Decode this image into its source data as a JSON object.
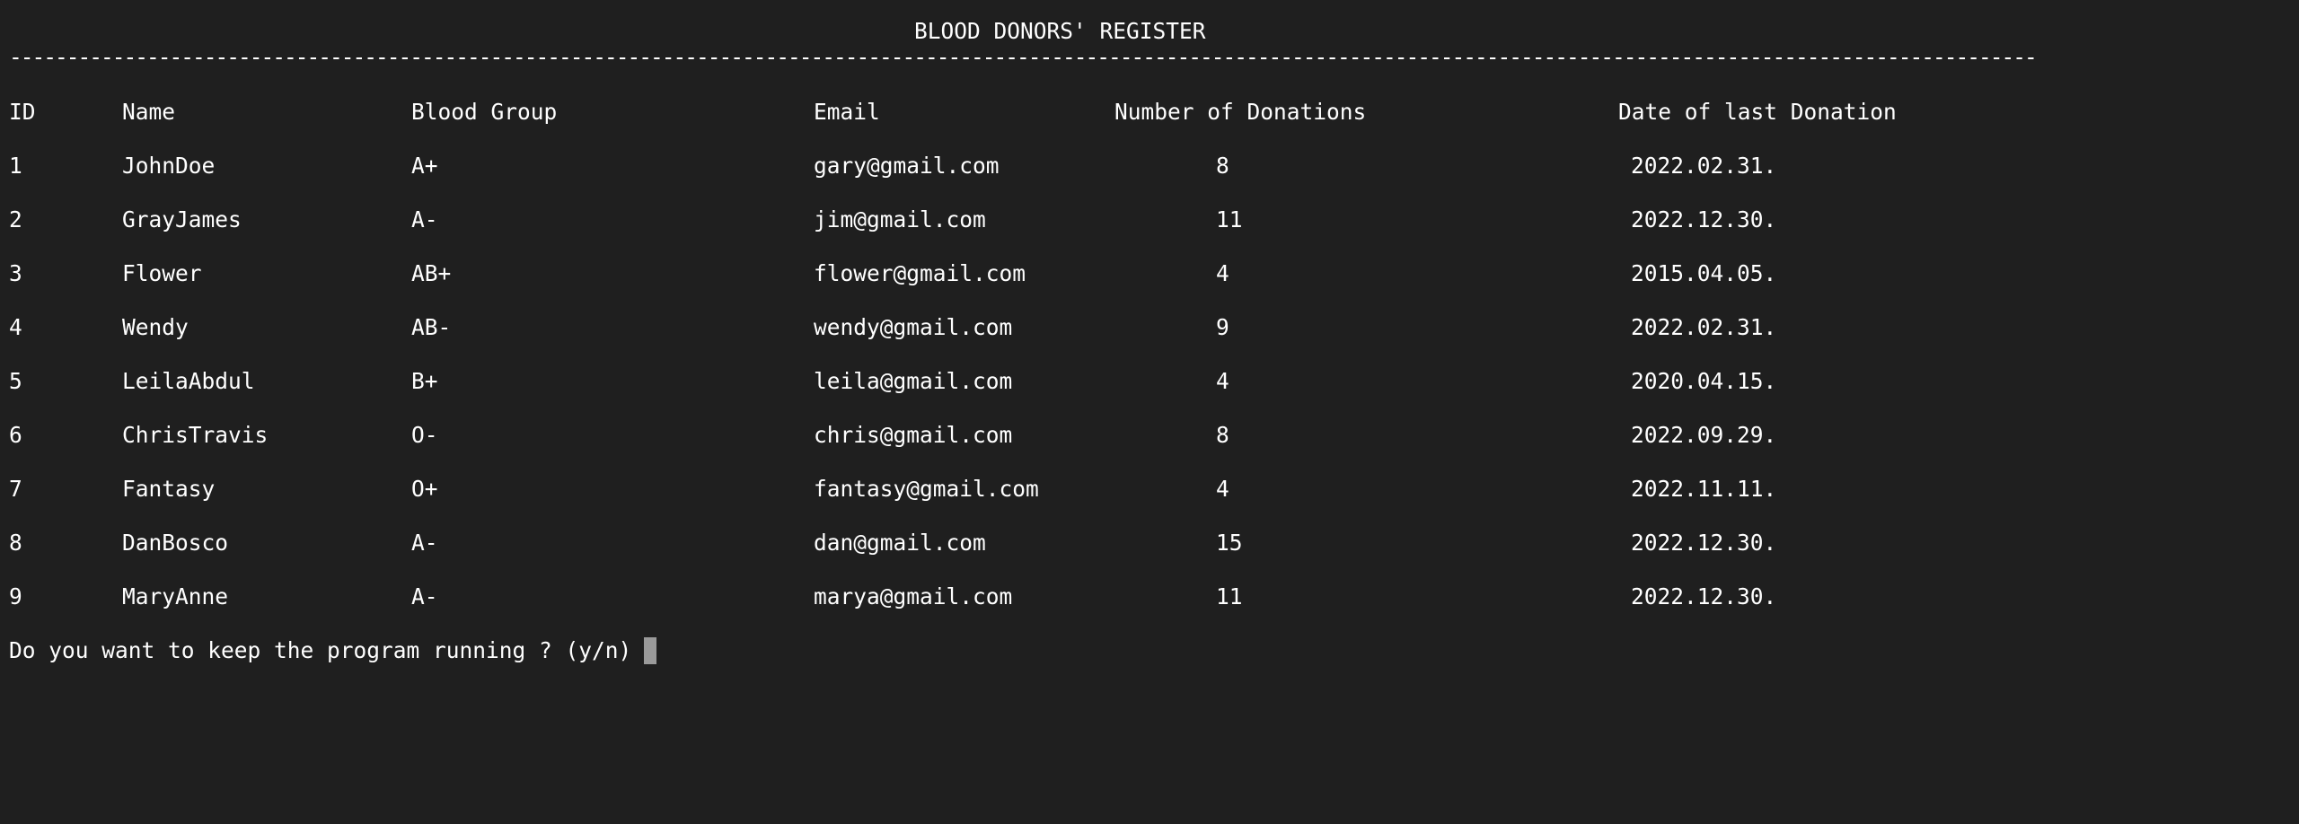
{
  "terminal": {
    "title": "BLOOD DONORS' REGISTER",
    "rule": "--------------------------------------------------------------------------------------------------------------------------------------------------------------------------------------------------------------------",
    "headers": {
      "id": "ID",
      "name": "Name",
      "blood_group": "Blood Group",
      "email": "Email",
      "donations": "Number of Donations",
      "last_date": "Date of last Donation"
    },
    "rows": [
      {
        "id": "1",
        "name": "JohnDoe",
        "blood_group": "A+",
        "email": "gary@gmail.com",
        "donations": "8",
        "last_date": "2022.02.31."
      },
      {
        "id": "2",
        "name": "GrayJames",
        "blood_group": "A-",
        "email": "jim@gmail.com",
        "donations": "11",
        "last_date": "2022.12.30."
      },
      {
        "id": "3",
        "name": "Flower",
        "blood_group": "AB+",
        "email": "flower@gmail.com",
        "donations": "4",
        "last_date": "2015.04.05."
      },
      {
        "id": "4",
        "name": "Wendy",
        "blood_group": "AB-",
        "email": "wendy@gmail.com",
        "donations": "9",
        "last_date": "2022.02.31."
      },
      {
        "id": "5",
        "name": "LeilaAbdul",
        "blood_group": "B+",
        "email": "leila@gmail.com",
        "donations": "4",
        "last_date": "2020.04.15."
      },
      {
        "id": "6",
        "name": "ChrisTravis",
        "blood_group": "O-",
        "email": "chris@gmail.com",
        "donations": "8",
        "last_date": "2022.09.29."
      },
      {
        "id": "7",
        "name": "Fantasy",
        "blood_group": "O+",
        "email": "fantasy@gmail.com",
        "donations": "4",
        "last_date": "2022.11.11."
      },
      {
        "id": "8",
        "name": "DanBosco",
        "blood_group": "A-",
        "email": "dan@gmail.com",
        "donations": "15",
        "last_date": "2022.12.30."
      },
      {
        "id": "9",
        "name": "MaryAnne",
        "blood_group": "A-",
        "email": "marya@gmail.com",
        "donations": "11",
        "last_date": "2022.12.30."
      }
    ],
    "prompt": "Do you want to keep the program running ? (y/n)"
  }
}
